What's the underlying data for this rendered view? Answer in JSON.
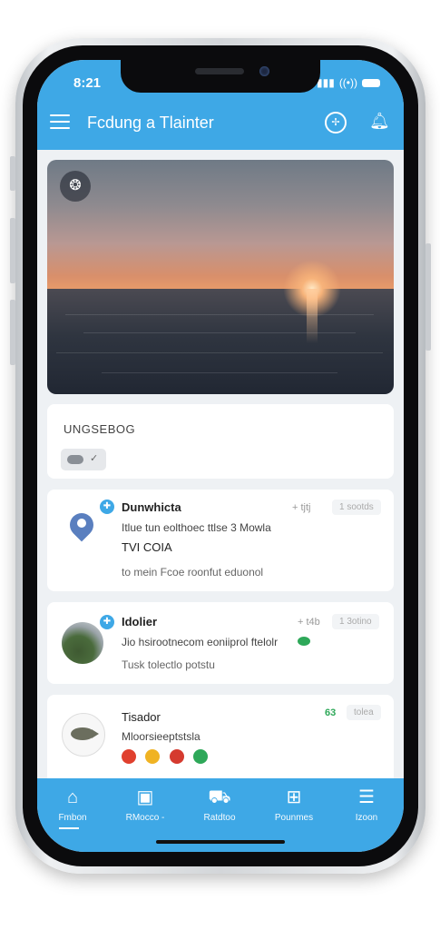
{
  "status_bar": {
    "time": "8:21",
    "signal": "▮▮▮",
    "wifi": "((•))"
  },
  "header": {
    "title": "Fcdung a Tlainter"
  },
  "hero": {
    "badge_icon": "camera-icon"
  },
  "info_card": {
    "title": "UNGSEBOG"
  },
  "feed": [
    {
      "name": "Dunwhicta",
      "line1": "Itlue tun eolthoec ttlse 3 Mowla",
      "line2": "TVI COIA",
      "line3": "to mein Fcoe roonfut eduonol",
      "meta": "+ tjtj",
      "chip": "1 sootds"
    },
    {
      "name": "Idolier",
      "line1": "Jio  hsirootnecom eoniiprol ftelolr",
      "line2": "Tusk tolectlo potstu",
      "meta": "+ t4b",
      "chip": "1 3otino"
    },
    {
      "name": "Tisador",
      "line1": "Mloorsieeptstsla",
      "meta": "63",
      "chip": "tolea",
      "dots": [
        "#e0402e",
        "#f0b323",
        "#d53a2f",
        "#2ea859"
      ]
    }
  ],
  "bottom_nav": [
    {
      "label": "Fmbon",
      "icon": "home-icon"
    },
    {
      "label": "RMocco -",
      "icon": "doc-icon"
    },
    {
      "label": "Ratdtoo",
      "icon": "car-icon"
    },
    {
      "label": "Pounmes",
      "icon": "grid-icon"
    },
    {
      "label": "Izoon",
      "icon": "menu-icon"
    }
  ],
  "colors": {
    "accent": "#3ea8e6",
    "screen_bg": "#eef1f4"
  }
}
